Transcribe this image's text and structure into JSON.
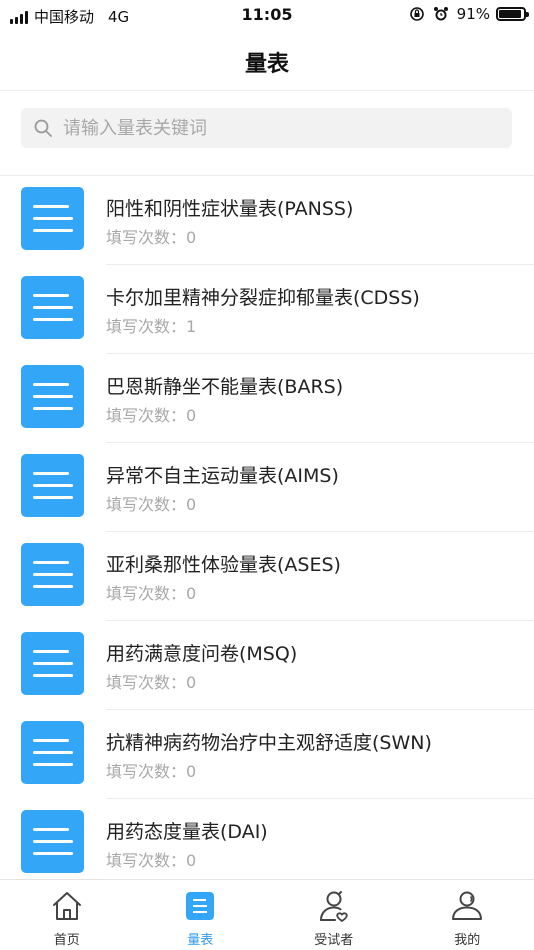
{
  "status_bar": {
    "carrier": "中国移动",
    "network": "4G",
    "time": "11:05",
    "battery_text": "91%",
    "battery_level": 0.91
  },
  "header": {
    "title": "量表"
  },
  "search": {
    "placeholder": "请输入量表关键词",
    "value": ""
  },
  "scales": [
    {
      "title": "阳性和阴性症状量表(PANSS)",
      "count_text": "填写次数：0"
    },
    {
      "title": "卡尔加里精神分裂症抑郁量表(CDSS)",
      "count_text": "填写次数：1"
    },
    {
      "title": "巴恩斯静坐不能量表(BARS)",
      "count_text": "填写次数：0"
    },
    {
      "title": "异常不自主运动量表(AIMS)",
      "count_text": "填写次数：0"
    },
    {
      "title": "亚利桑那性体验量表(ASES)",
      "count_text": "填写次数：0"
    },
    {
      "title": "用药满意度问卷(MSQ)",
      "count_text": "填写次数：0"
    },
    {
      "title": "抗精神病药物治疗中主观舒适度(SWN)",
      "count_text": "填写次数：0"
    },
    {
      "title": "用药态度量表(DAI)",
      "count_text": "填写次数：0"
    }
  ],
  "tabbar": {
    "items": [
      {
        "label": "首页",
        "icon": "home-icon",
        "active": false
      },
      {
        "label": "量表",
        "icon": "list-icon",
        "active": true
      },
      {
        "label": "受试者",
        "icon": "subject-icon",
        "active": false
      },
      {
        "label": "我的",
        "icon": "profile-icon",
        "active": false
      }
    ]
  },
  "colors": {
    "accent": "#2f9af1",
    "list_icon_bg": "#33a6f7",
    "secondary_text": "#a8a8a8"
  }
}
